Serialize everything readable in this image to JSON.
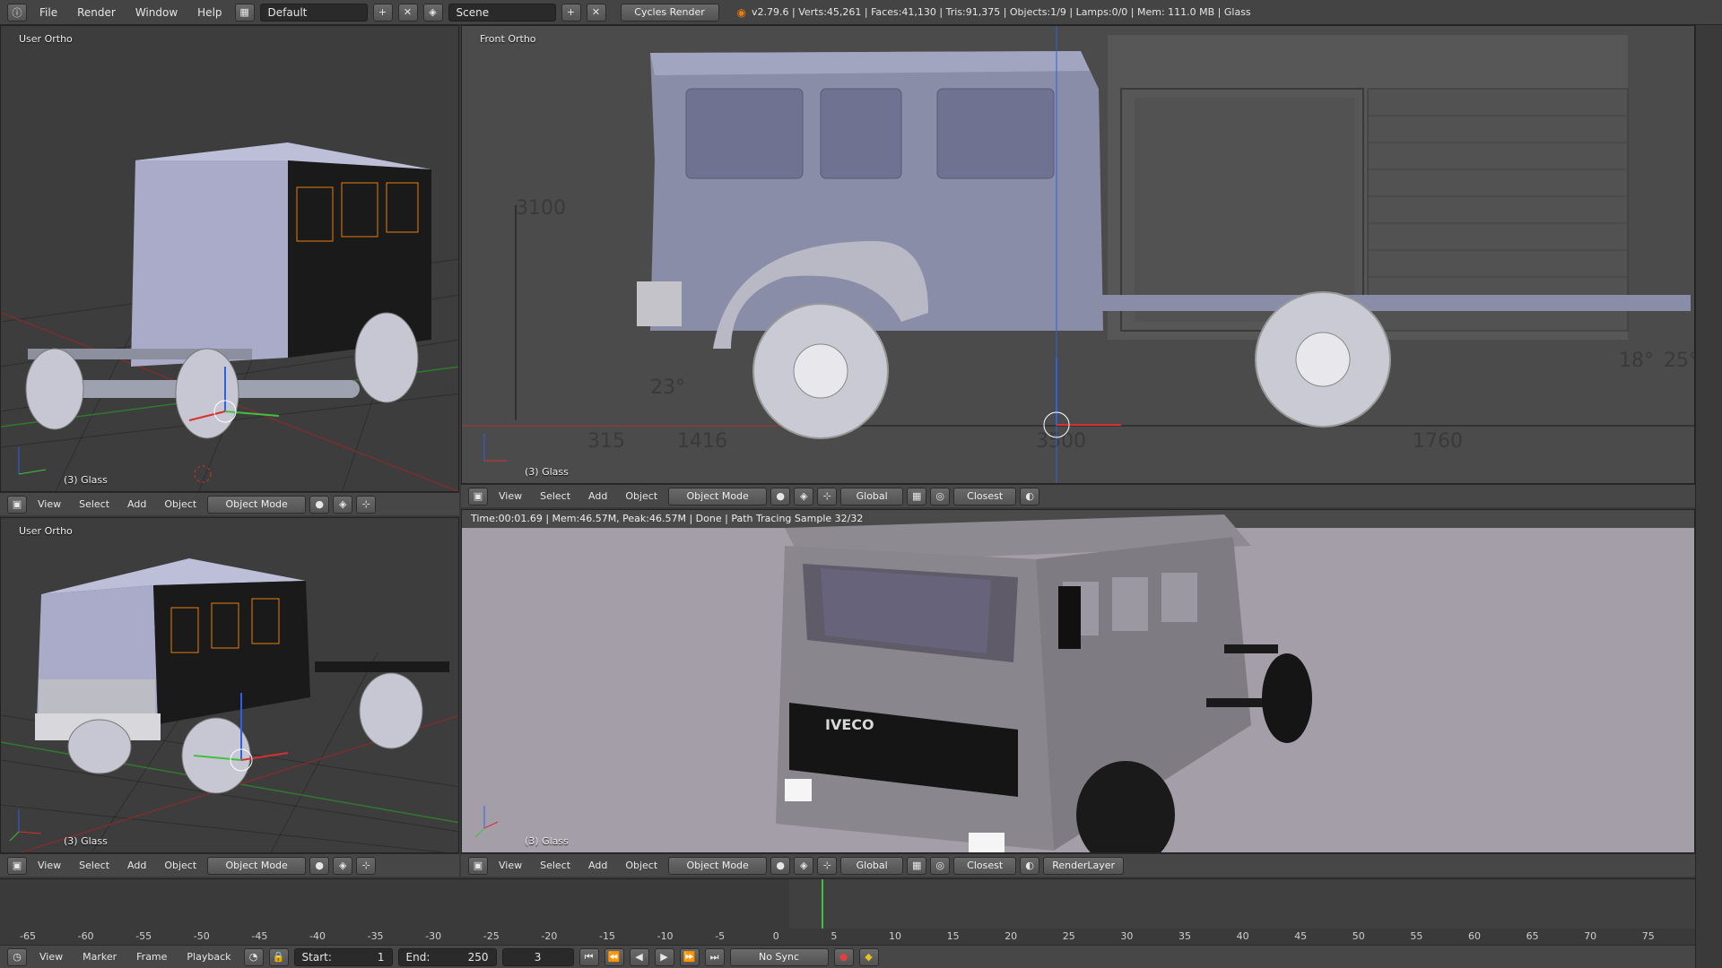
{
  "topbar": {
    "menus": [
      "File",
      "Render",
      "Window",
      "Help"
    ],
    "layout_name": "Default",
    "scene_name": "Scene",
    "render_engine": "Cycles Render",
    "stats": "v2.79.6 | Verts:45,261 | Faces:41,130 | Tris:91,375 | Objects:1/9 | Lamps:0/0 | Mem: 111.0 MB | Glass"
  },
  "viewports": {
    "top_left": {
      "label": "User Ortho",
      "object": "(3) Glass"
    },
    "top_right": {
      "label": "Front Ortho",
      "object": "(3) Glass"
    },
    "bottom_left": {
      "label": "User Ortho",
      "object": "(3) Glass"
    },
    "bottom_right": {
      "status": "Time:00:01.69 | Mem:46.57M, Peak:46.57M | Done | Path Tracing Sample 32/32",
      "object": "(3) Glass",
      "brand": "IVECO"
    }
  },
  "dimensions": {
    "d3100": "3100",
    "d315": "315",
    "d1416": "1416",
    "d3500": "3500",
    "d1760": "1760",
    "a23": "23°",
    "a25": "25°",
    "a18": "18°"
  },
  "viewport_header": {
    "menu": [
      "View",
      "Select",
      "Add",
      "Object"
    ],
    "mode": "Object Mode",
    "orientation": "Global",
    "snap": "Closest",
    "render_layer": "RenderLayer"
  },
  "timeline": {
    "ticks": [
      "-65",
      "-60",
      "-55",
      "-50",
      "-45",
      "-40",
      "-35",
      "-30",
      "-25",
      "-20",
      "-15",
      "-10",
      "-5",
      "0",
      "5",
      "10",
      "15",
      "20",
      "25",
      "30",
      "35",
      "40",
      "45",
      "50",
      "55",
      "60",
      "65",
      "70",
      "75"
    ],
    "menu": [
      "View",
      "Marker",
      "Frame",
      "Playback"
    ],
    "start_label": "Start:",
    "start": "1",
    "end_label": "End:",
    "end": "250",
    "current": "3",
    "sync": "No Sync"
  },
  "colors": {
    "accent_orange": "#e87d0d",
    "axis_red": "#d83030",
    "axis_green": "#40c040",
    "axis_blue": "#3060e0",
    "render_bg": "#a49ea8"
  }
}
